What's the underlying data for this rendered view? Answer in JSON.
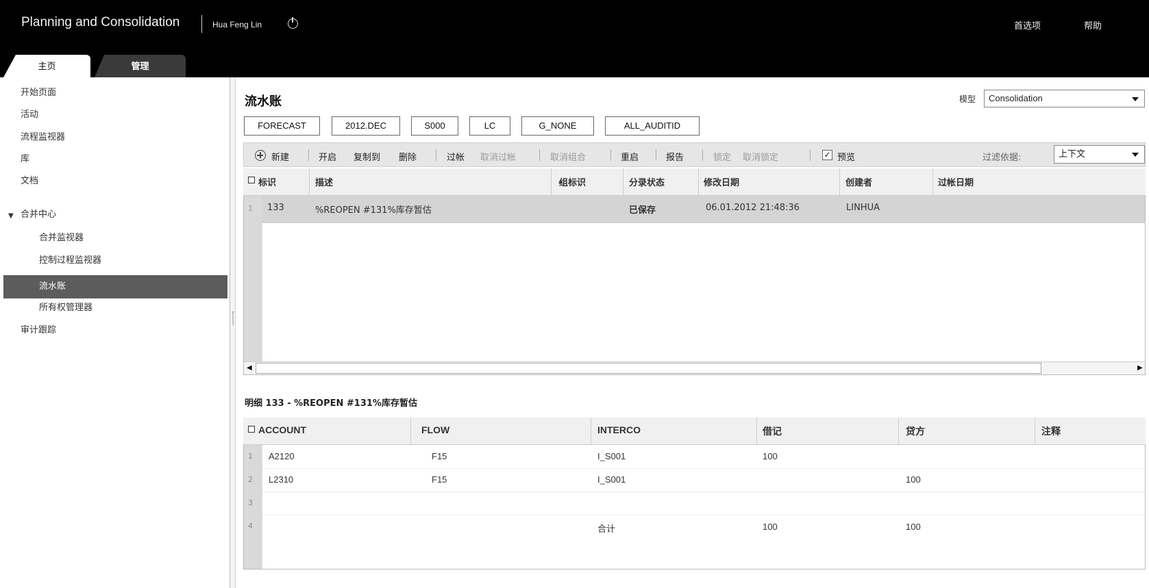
{
  "header": {
    "app_title": "Planning and Consolidation",
    "user_name": "Hua Feng Lin",
    "preferences": "首选项",
    "help": "帮助"
  },
  "tabs": {
    "home": "主页",
    "admin": "管理"
  },
  "sidebar": {
    "items": [
      "开始页面",
      "活动",
      "流程监视器",
      "库",
      "文档",
      "合并中心",
      "合并监视器",
      "控制过程监视器",
      "流水账",
      "所有权管理器",
      "审计跟踪"
    ]
  },
  "main": {
    "title": "流水账",
    "model_label": "模型",
    "model_value": "Consolidation",
    "context": [
      "FORECAST",
      "2012.DEC",
      "S000",
      "LC",
      "G_NONE",
      "ALL_AUDITID"
    ],
    "toolbar": {
      "new": "新建",
      "open": "开启",
      "copy_to": "复制到",
      "delete": "删除",
      "post": "过帐",
      "unpost": "取消过帐",
      "ungroup": "取消组合",
      "reopen": "重启",
      "report": "报告",
      "lock": "锁定",
      "unlock": "取消锁定",
      "preview": "预览",
      "filter_label": "过滤依据:",
      "filter_value": "上下文"
    },
    "journal_grid": {
      "headers": [
        "标识",
        "描述",
        "组标识",
        "分录状态",
        "修改日期",
        "创建者",
        "过帐日期"
      ],
      "rows": [
        {
          "num": "1",
          "id": "133",
          "desc": "%REOPEN #131%库存暂估",
          "group": "",
          "status": "已保存",
          "modified": "06.01.2012 21:48:36",
          "creator": "LINHUA",
          "posted": ""
        }
      ]
    },
    "detail": {
      "title": "明细 133 - %REOPEN #131%库存暂估",
      "headers": [
        "ACCOUNT",
        "FLOW",
        "INTERCO",
        "借记",
        "贷方",
        "注释"
      ],
      "rows": [
        {
          "num": "1",
          "account": "A2120",
          "flow": "F15",
          "interco": "I_S001",
          "debit": "100",
          "credit": ""
        },
        {
          "num": "2",
          "account": "L2310",
          "flow": "F15",
          "interco": "I_S001",
          "debit": "",
          "credit": "100"
        },
        {
          "num": "3",
          "account": "",
          "flow": "",
          "interco": "",
          "debit": "",
          "credit": ""
        },
        {
          "num": "4",
          "account": "",
          "flow": "",
          "interco": "合计",
          "debit": "100",
          "credit": "100"
        }
      ]
    }
  }
}
